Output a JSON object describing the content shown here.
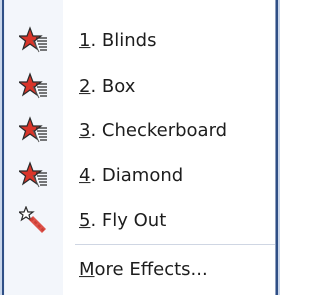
{
  "menu": {
    "items": [
      {
        "key": "1",
        "rest": ". Blinds",
        "icon": "animation-effect-icon"
      },
      {
        "key": "2",
        "rest": ". Box",
        "icon": "animation-effect-icon"
      },
      {
        "key": "3",
        "rest": ". Checkerboard",
        "icon": "animation-effect-icon"
      },
      {
        "key": "4",
        "rest": ". Diamond",
        "icon": "animation-effect-icon"
      },
      {
        "key": "5",
        "rest": ". Fly Out",
        "icon": "animation-fly-icon"
      }
    ],
    "more": {
      "key": "M",
      "rest": "ore Effects..."
    }
  },
  "colors": {
    "star_red": "#d9352a",
    "star_outline": "#2a2a2a",
    "gutter": "#f3f6fb",
    "border": "#2f4f86"
  }
}
